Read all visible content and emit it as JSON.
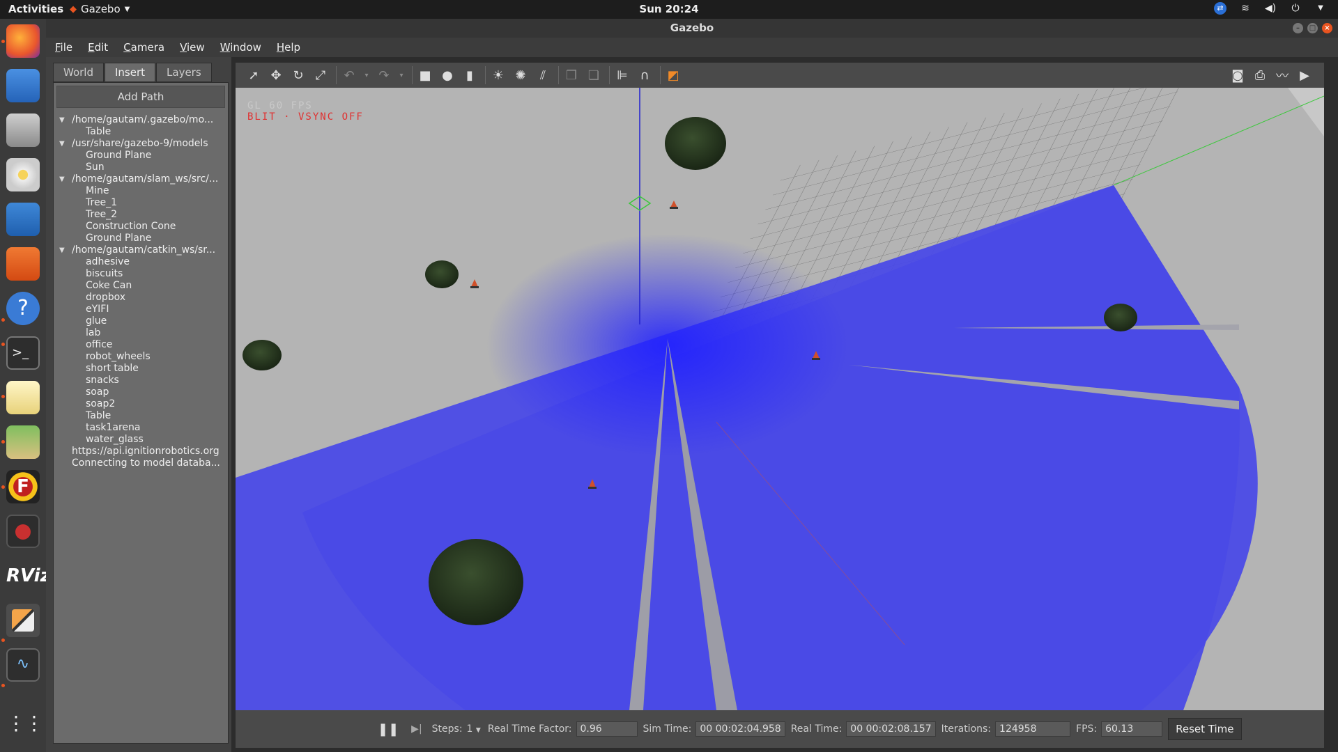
{
  "topbar": {
    "activities": "Activities",
    "app_name": "Gazebo",
    "clock": "Sun 20:24"
  },
  "window": {
    "title": "Gazebo"
  },
  "menu": [
    "File",
    "Edit",
    "Camera",
    "View",
    "Window",
    "Help"
  ],
  "left_panel": {
    "tabs": [
      "World",
      "Insert",
      "Layers"
    ],
    "active_tab": "Insert",
    "add_path_label": "Add Path",
    "groups": [
      {
        "path": "/home/gautam/.gazebo/mo...",
        "items": [
          "Table"
        ]
      },
      {
        "path": "/usr/share/gazebo-9/models",
        "items": [
          "Ground Plane",
          "Sun"
        ]
      },
      {
        "path": "/home/gautam/slam_ws/src/...",
        "items": [
          "Mine",
          "Tree_1",
          "Tree_2",
          "Construction Cone",
          "Ground Plane"
        ]
      },
      {
        "path": "/home/gautam/catkin_ws/sr...",
        "items": [
          "adhesive",
          "biscuits",
          "Coke Can",
          "dropbox",
          "eYIFI",
          "glue",
          "lab",
          "office",
          "robot_wheels",
          "short table",
          "snacks",
          "soap",
          "soap2",
          "Table",
          "task1arena",
          "water_glass"
        ]
      }
    ],
    "footer_items": [
      "https://api.ignitionrobotics.org",
      "Connecting to model databa..."
    ]
  },
  "viewport": {
    "overlay_fps": "GL 60 FPS",
    "overlay_blit": "BLIT · VSYNC OFF",
    "colors": {
      "background": "#b4b4b4",
      "laser": "#4848e8",
      "tree": "#25351f",
      "grid": "#555555"
    }
  },
  "bottom_bar": {
    "steps_label": "Steps:",
    "steps_value": "1",
    "rtf_label": "Real Time Factor:",
    "rtf_value": "0.96",
    "sim_time_label": "Sim Time:",
    "sim_time_value": "00 00:02:04.958",
    "real_time_label": "Real Time:",
    "real_time_value": "00 00:02:08.157",
    "iterations_label": "Iterations:",
    "iterations_value": "124958",
    "fps_label": "FPS:",
    "fps_value": "60.13",
    "reset_label": "Reset Time"
  }
}
